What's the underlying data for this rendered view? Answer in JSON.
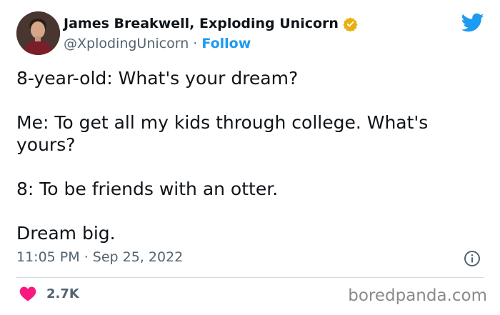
{
  "author": {
    "name": "James Breakwell, Exploding Unicorn",
    "handle": "@XplodingUnicorn",
    "separator": "·",
    "follow_label": "Follow",
    "verified_badge_color": "#e8b00f"
  },
  "icons": {
    "logo": "twitter-bird-icon",
    "verified": "verified-badge-icon",
    "info": "info-icon",
    "like": "heart-icon"
  },
  "colors": {
    "twitter_blue": "#1d9bf0",
    "like_red": "#f91880",
    "text_primary": "#0f1419",
    "text_secondary": "#536471"
  },
  "tweet": {
    "lines": [
      "8-year-old: What's your dream?",
      "Me: To get all my kids through college. What's yours?",
      "8: To be friends with an otter.",
      "Dream big."
    ],
    "time": "11:05 PM",
    "date": "Sep 25, 2022",
    "timestamp_separator": "·"
  },
  "engagement": {
    "likes": "2.7K"
  },
  "watermark": "boredpanda.com"
}
